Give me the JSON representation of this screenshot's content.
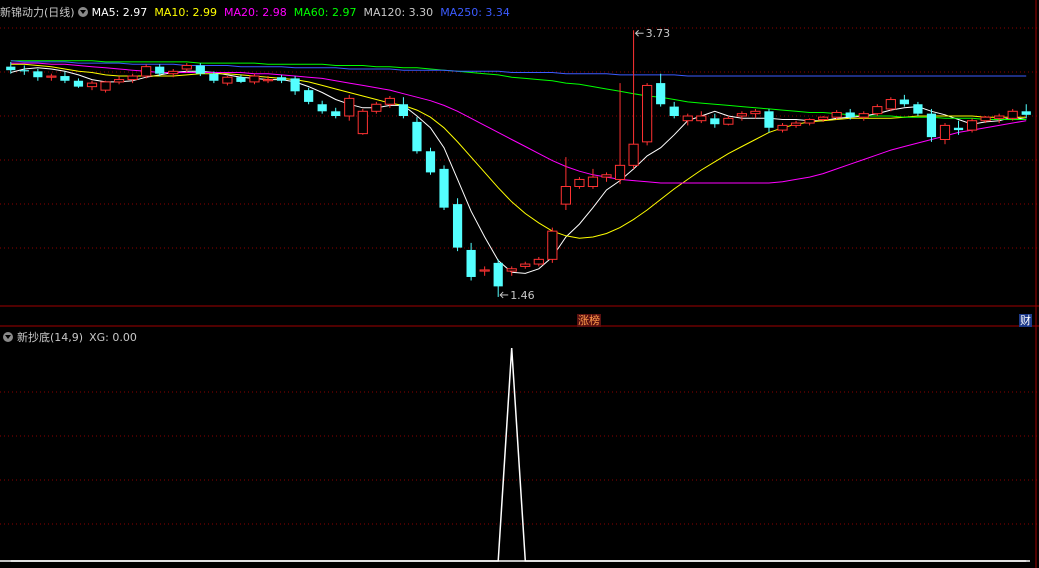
{
  "main_header": {
    "name": "新锦动力",
    "period": "(日线)",
    "indicators": [
      {
        "label": "MA5: 2.97",
        "color": "#ffffff"
      },
      {
        "label": "MA10: 2.99",
        "color": "#ffff00"
      },
      {
        "label": "MA20: 2.98",
        "color": "#ff00ff"
      },
      {
        "label": "MA60: 2.97",
        "color": "#00ff00"
      },
      {
        "label": "MA120: 3.30",
        "color": "#c8c8c8"
      },
      {
        "label": "MA250: 3.34",
        "color": "#3b5bff"
      }
    ]
  },
  "sub_header": {
    "name": "新抄底(14,9)",
    "value_label": "XG: 0.00"
  },
  "badges": {
    "limit_list": "涨榜",
    "finance": "财"
  },
  "colors": {
    "up": "#ff3232",
    "down": "#54ffff",
    "ma5": "#ffffff",
    "ma10": "#ffff00",
    "ma20": "#ff00ff",
    "ma60": "#00ff00",
    "ma250": "#3b5bff",
    "grid": "#8b0000",
    "axis": "#a00000"
  },
  "chart_data": [
    {
      "type": "candlestick",
      "title": "新锦动力 (日线)",
      "ylim": [
        1.4,
        3.8
      ],
      "annotations": [
        {
          "label": "3.73",
          "kind": "high",
          "value": 3.73,
          "index": 46
        },
        {
          "label": "1.46",
          "kind": "low",
          "value": 1.46,
          "index": 36
        }
      ],
      "candles": [
        [
          3.42,
          3.46,
          3.36,
          3.39
        ],
        [
          3.39,
          3.43,
          3.35,
          3.38
        ],
        [
          3.38,
          3.4,
          3.3,
          3.33
        ],
        [
          3.33,
          3.36,
          3.3,
          3.34
        ],
        [
          3.34,
          3.38,
          3.28,
          3.3
        ],
        [
          3.3,
          3.32,
          3.24,
          3.25
        ],
        [
          3.25,
          3.3,
          3.22,
          3.28
        ],
        [
          3.22,
          3.3,
          3.2,
          3.29
        ],
        [
          3.29,
          3.34,
          3.27,
          3.31
        ],
        [
          3.31,
          3.36,
          3.28,
          3.34
        ],
        [
          3.34,
          3.44,
          3.32,
          3.42
        ],
        [
          3.42,
          3.44,
          3.34,
          3.36
        ],
        [
          3.36,
          3.4,
          3.33,
          3.38
        ],
        [
          3.4,
          3.45,
          3.37,
          3.43
        ],
        [
          3.43,
          3.45,
          3.34,
          3.36
        ],
        [
          3.36,
          3.38,
          3.28,
          3.3
        ],
        [
          3.28,
          3.34,
          3.26,
          3.33
        ],
        [
          3.33,
          3.35,
          3.28,
          3.29
        ],
        [
          3.29,
          3.36,
          3.27,
          3.34
        ],
        [
          3.3,
          3.34,
          3.28,
          3.31
        ],
        [
          3.33,
          3.35,
          3.28,
          3.3
        ],
        [
          3.32,
          3.34,
          3.18,
          3.21
        ],
        [
          3.22,
          3.24,
          3.1,
          3.12
        ],
        [
          3.1,
          3.13,
          3.02,
          3.04
        ],
        [
          3.04,
          3.07,
          2.98,
          3.0
        ],
        [
          3.0,
          3.18,
          2.96,
          3.15
        ],
        [
          2.85,
          3.06,
          2.84,
          3.04
        ],
        [
          3.04,
          3.12,
          3.02,
          3.1
        ],
        [
          3.1,
          3.17,
          3.07,
          3.15
        ],
        [
          3.1,
          3.16,
          2.98,
          3.0
        ],
        [
          2.95,
          2.99,
          2.68,
          2.7
        ],
        [
          2.7,
          2.73,
          2.5,
          2.52
        ],
        [
          2.55,
          2.58,
          2.2,
          2.22
        ],
        [
          2.25,
          2.3,
          1.85,
          1.88
        ],
        [
          1.86,
          1.92,
          1.6,
          1.63
        ],
        [
          1.68,
          1.72,
          1.64,
          1.69
        ],
        [
          1.75,
          1.78,
          1.46,
          1.55
        ],
        [
          1.68,
          1.72,
          1.64,
          1.7
        ],
        [
          1.72,
          1.76,
          1.7,
          1.74
        ],
        [
          1.74,
          1.8,
          1.72,
          1.78
        ],
        [
          1.78,
          2.05,
          1.75,
          2.02
        ],
        [
          2.25,
          2.65,
          2.2,
          2.4
        ],
        [
          2.4,
          2.48,
          2.38,
          2.46
        ],
        [
          2.4,
          2.55,
          2.38,
          2.48
        ],
        [
          2.48,
          2.52,
          2.44,
          2.5
        ],
        [
          2.46,
          3.28,
          2.42,
          2.58
        ],
        [
          2.58,
          3.73,
          2.55,
          2.76
        ],
        [
          2.78,
          3.28,
          2.75,
          3.26
        ],
        [
          3.28,
          3.36,
          3.08,
          3.1
        ],
        [
          3.08,
          3.12,
          2.98,
          3.0
        ],
        [
          2.96,
          3.02,
          2.92,
          3.0
        ],
        [
          2.96,
          3.04,
          2.94,
          3.0
        ],
        [
          2.98,
          3.02,
          2.9,
          2.93
        ],
        [
          2.93,
          3.0,
          2.92,
          2.98
        ],
        [
          3.0,
          3.04,
          2.96,
          3.02
        ],
        [
          3.02,
          3.06,
          2.98,
          3.04
        ],
        [
          3.04,
          3.06,
          2.86,
          2.9
        ],
        [
          2.88,
          2.94,
          2.86,
          2.92
        ],
        [
          2.92,
          2.96,
          2.9,
          2.94
        ],
        [
          2.94,
          2.98,
          2.92,
          2.97
        ],
        [
          2.97,
          3.0,
          2.95,
          2.99
        ],
        [
          2.99,
          3.05,
          2.97,
          3.03
        ],
        [
          3.03,
          3.06,
          2.97,
          2.99
        ],
        [
          2.99,
          3.04,
          2.96,
          3.02
        ],
        [
          3.02,
          3.1,
          3.0,
          3.08
        ],
        [
          3.06,
          3.16,
          3.04,
          3.14
        ],
        [
          3.14,
          3.18,
          3.08,
          3.1
        ],
        [
          3.1,
          3.12,
          3.0,
          3.02
        ],
        [
          3.02,
          3.06,
          2.78,
          2.82
        ],
        [
          2.8,
          2.94,
          2.76,
          2.92
        ],
        [
          2.9,
          2.96,
          2.84,
          2.88
        ],
        [
          2.88,
          2.98,
          2.86,
          2.96
        ],
        [
          2.96,
          3.0,
          2.94,
          2.99
        ],
        [
          2.98,
          3.02,
          2.94,
          3.0
        ],
        [
          2.98,
          3.06,
          2.96,
          3.04
        ],
        [
          3.04,
          3.1,
          2.98,
          3.01
        ]
      ],
      "series": [
        {
          "name": "MA5",
          "values": [
            3.37,
            3.4,
            3.41,
            3.4,
            3.38,
            3.35,
            3.31,
            3.29,
            3.29,
            3.3,
            3.33,
            3.35,
            3.37,
            3.38,
            3.38,
            3.37,
            3.35,
            3.33,
            3.32,
            3.31,
            3.31,
            3.29,
            3.25,
            3.2,
            3.14,
            3.1,
            3.07,
            3.07,
            3.09,
            3.09,
            3.0,
            2.9,
            2.73,
            2.46,
            2.19,
            1.97,
            1.77,
            1.67,
            1.66,
            1.7,
            1.8,
            1.97,
            2.08,
            2.22,
            2.37,
            2.45,
            2.55,
            2.66,
            2.73,
            2.84,
            2.96,
            3.0,
            3.04,
            3.0,
            2.98,
            2.98,
            2.98,
            2.97,
            2.97,
            2.96,
            2.96,
            2.98,
            2.99,
            3.0,
            3.02,
            3.05,
            3.07,
            3.08,
            3.04,
            3.01,
            2.97,
            2.93,
            2.95,
            2.96,
            2.99,
            2.97
          ]
        },
        {
          "name": "MA10",
          "values": [
            3.44,
            3.44,
            3.43,
            3.42,
            3.4,
            3.38,
            3.37,
            3.35,
            3.34,
            3.34,
            3.34,
            3.34,
            3.34,
            3.35,
            3.36,
            3.36,
            3.36,
            3.35,
            3.34,
            3.33,
            3.32,
            3.31,
            3.29,
            3.26,
            3.23,
            3.2,
            3.17,
            3.14,
            3.11,
            3.09,
            3.05,
            2.99,
            2.9,
            2.78,
            2.65,
            2.52,
            2.39,
            2.27,
            2.17,
            2.09,
            2.02,
            1.98,
            1.96,
            1.97,
            2.0,
            2.05,
            2.12,
            2.2,
            2.29,
            2.38,
            2.46,
            2.54,
            2.61,
            2.68,
            2.74,
            2.8,
            2.86,
            2.9,
            2.93,
            2.95,
            2.96,
            2.97,
            2.98,
            2.98,
            2.98,
            2.98,
            2.99,
            3.0,
            3.0,
            3.0,
            3.0,
            3.0,
            2.99,
            2.99,
            2.99,
            2.99
          ]
        },
        {
          "name": "MA20",
          "values": [
            3.45,
            3.45,
            3.45,
            3.44,
            3.44,
            3.43,
            3.42,
            3.41,
            3.4,
            3.39,
            3.38,
            3.37,
            3.37,
            3.37,
            3.37,
            3.37,
            3.37,
            3.37,
            3.36,
            3.36,
            3.35,
            3.34,
            3.33,
            3.32,
            3.3,
            3.28,
            3.26,
            3.24,
            3.22,
            3.19,
            3.16,
            3.13,
            3.09,
            3.04,
            2.98,
            2.92,
            2.86,
            2.8,
            2.74,
            2.68,
            2.62,
            2.57,
            2.53,
            2.5,
            2.48,
            2.46,
            2.45,
            2.44,
            2.43,
            2.43,
            2.43,
            2.43,
            2.43,
            2.43,
            2.43,
            2.43,
            2.43,
            2.44,
            2.46,
            2.48,
            2.51,
            2.55,
            2.59,
            2.63,
            2.67,
            2.71,
            2.74,
            2.77,
            2.8,
            2.83,
            2.86,
            2.88,
            2.9,
            2.92,
            2.94,
            2.96
          ]
        },
        {
          "name": "MA60",
          "values": [
            3.47,
            3.47,
            3.47,
            3.47,
            3.47,
            3.47,
            3.47,
            3.46,
            3.46,
            3.46,
            3.46,
            3.46,
            3.46,
            3.46,
            3.45,
            3.45,
            3.45,
            3.45,
            3.45,
            3.44,
            3.44,
            3.44,
            3.44,
            3.44,
            3.43,
            3.43,
            3.43,
            3.42,
            3.42,
            3.41,
            3.41,
            3.4,
            3.39,
            3.38,
            3.37,
            3.36,
            3.35,
            3.33,
            3.32,
            3.31,
            3.3,
            3.28,
            3.27,
            3.25,
            3.23,
            3.21,
            3.19,
            3.17,
            3.16,
            3.14,
            3.12,
            3.11,
            3.1,
            3.09,
            3.08,
            3.07,
            3.06,
            3.05,
            3.04,
            3.03,
            3.03,
            3.02,
            3.01,
            3.0,
            3.0,
            3.0,
            2.99,
            2.99,
            2.99,
            2.98,
            2.98,
            2.98,
            2.97,
            2.97,
            2.97,
            2.97
          ]
        },
        {
          "name": "MA250",
          "values": [
            3.47,
            3.46,
            3.46,
            3.46,
            3.46,
            3.45,
            3.45,
            3.45,
            3.45,
            3.44,
            3.44,
            3.44,
            3.44,
            3.43,
            3.43,
            3.43,
            3.43,
            3.42,
            3.42,
            3.42,
            3.42,
            3.41,
            3.41,
            3.41,
            3.41,
            3.4,
            3.4,
            3.4,
            3.4,
            3.39,
            3.39,
            3.39,
            3.39,
            3.38,
            3.38,
            3.38,
            3.38,
            3.37,
            3.37,
            3.37,
            3.37,
            3.36,
            3.36,
            3.36,
            3.36,
            3.35,
            3.35,
            3.35,
            3.35,
            3.35,
            3.34,
            3.34,
            3.34,
            3.34,
            3.34,
            3.34,
            3.34,
            3.34,
            3.34,
            3.34,
            3.34,
            3.34,
            3.34,
            3.34,
            3.34,
            3.34,
            3.34,
            3.34,
            3.34,
            3.34,
            3.34,
            3.34,
            3.34,
            3.34,
            3.34,
            3.34
          ]
        }
      ]
    },
    {
      "type": "line",
      "title": "新抄底(14,9)",
      "series": [
        {
          "name": "XG",
          "values": [
            0,
            0,
            0,
            0,
            0,
            0,
            0,
            0,
            0,
            0,
            0,
            0,
            0,
            0,
            0,
            0,
            0,
            0,
            0,
            0,
            0,
            0,
            0,
            0,
            0,
            0,
            0,
            0,
            0,
            0,
            0,
            0,
            0,
            0,
            0,
            0,
            0,
            1,
            0,
            0,
            0,
            0,
            0,
            0,
            0,
            0,
            0,
            0,
            0,
            0,
            0,
            0,
            0,
            0,
            0,
            0,
            0,
            0,
            0,
            0,
            0,
            0,
            0,
            0,
            0,
            0,
            0,
            0,
            0,
            0,
            0,
            0,
            0,
            0,
            0,
            0
          ]
        }
      ],
      "ylim": [
        0,
        1
      ]
    }
  ]
}
